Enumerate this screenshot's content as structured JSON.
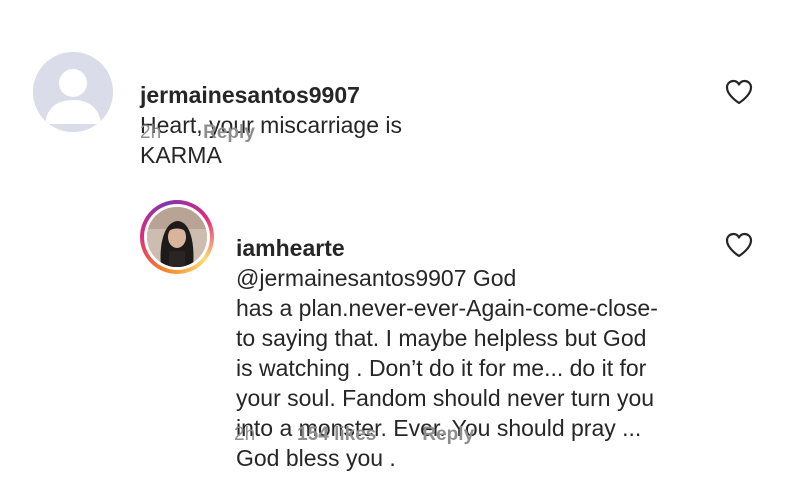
{
  "comments": [
    {
      "username": "jermainesantos9907",
      "text": "Heart, your miscarriage is\nKARMA",
      "time": "2h",
      "reply_label": "Reply",
      "avatar": "default-avatar-icon",
      "liked": false
    },
    {
      "username": "iamhearte",
      "text": "@jermainesantos9907 God\nhas a plan.never-ever-Again-come-close-\nto saying that. I maybe helpless but God\nis watching . Don’t do it for me... do it for\nyour soul. Fandom should never turn you\ninto a monster. Ever. You should pray ...\nGod bless you .",
      "time": "2h",
      "likes": "154 likes",
      "reply_label": "Reply",
      "avatar": "profile-photo",
      "liked": false
    }
  ],
  "colors": {
    "text": "#262626",
    "meta": "#8e8e8e",
    "default_avatar_bg": "#dadde9",
    "default_avatar_fg": "#ffffff"
  },
  "icons": {
    "like": "heart-outline-icon"
  }
}
